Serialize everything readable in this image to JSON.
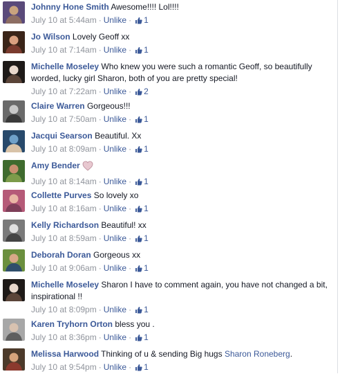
{
  "comments": [
    {
      "name": "Johnny Hone Smith",
      "text": "Awesome!!!! Lol!!!!",
      "time": "July 10 at 5:44am",
      "action": "Unlike",
      "likes": "1",
      "avatar_colors": [
        "#5a4a7a",
        "#c9a37e",
        "#8d6e63"
      ]
    },
    {
      "name": "Jo Wilson",
      "text": "Lovely Geoff xx",
      "time": "July 10 at 7:14am",
      "action": "Unlike",
      "likes": "1",
      "avatar_colors": [
        "#3a2418",
        "#d9a080",
        "#7a3b2e"
      ]
    },
    {
      "name": "Michelle Moseley",
      "text": "Who knew you were such a romantic Geoff, so beautifully worded, lucky girl Sharon, both of you are pretty special!",
      "time": "July 10 at 7:22am",
      "action": "Unlike",
      "likes": "2",
      "avatar_colors": [
        "#1e1a18",
        "#e8d8cc",
        "#5a4438"
      ]
    },
    {
      "name": "Claire Warren",
      "text": "Gorgeous!!!",
      "time": "July 10 at 7:50am",
      "action": "Unlike",
      "likes": "1",
      "avatar_colors": [
        "#6a6a6a",
        "#c8c8c8",
        "#3a3a3a"
      ]
    },
    {
      "name": "Jacqui Searson",
      "text": "Beautiful. Xx",
      "time": "July 10 at 8:09am",
      "action": "Unlike",
      "likes": "1",
      "avatar_colors": [
        "#27496b",
        "#6fa1c9",
        "#d8c3a8"
      ]
    },
    {
      "name": "Amy Bender",
      "text": "",
      "heart": true,
      "time": "July 10 at 8:14am",
      "action": "Unlike",
      "likes": "1",
      "avatar_colors": [
        "#3f6b2e",
        "#c89070",
        "#7c9b4a"
      ]
    },
    {
      "name": "Collette Purves",
      "text": "So lovely xo",
      "time": "July 10 at 8:16am",
      "action": "Unlike",
      "likes": "1",
      "avatar_colors": [
        "#b55a78",
        "#e9b7a5",
        "#7e3f59"
      ]
    },
    {
      "name": "Kelly Richardson",
      "text": "Beautiful! xx",
      "time": "July 10 at 8:59am",
      "action": "Unlike",
      "likes": "1",
      "avatar_colors": [
        "#7a7a7a",
        "#e0e0e0",
        "#444444"
      ]
    },
    {
      "name": "Deborah Doran",
      "text": "Gorgeous xx",
      "time": "July 10 at 9:06am",
      "action": "Unlike",
      "likes": "1",
      "avatar_colors": [
        "#6b8f3e",
        "#d7a888",
        "#2f4e6b"
      ]
    },
    {
      "name": "Michelle Moseley",
      "text": "Sharon I have to comment again, you have not changed a bit, inspirational !!",
      "time": "July 10 at 8:09pm",
      "action": "Unlike",
      "likes": "1",
      "avatar_colors": [
        "#1e1a18",
        "#e8d8cc",
        "#5a4438"
      ]
    },
    {
      "name": "Karen Tryhorn Orton",
      "text": "bless you .",
      "time": "July 10 at 8:36pm",
      "action": "Unlike",
      "likes": "1",
      "avatar_colors": [
        "#a7a7a7",
        "#d8c2b0",
        "#5f5f5f"
      ]
    },
    {
      "name": "Melissa Harwood",
      "text": "Thinking of u & sending Big hugs",
      "mention": "Sharon Roneberg",
      "text_after": ".",
      "time": "July 10 at 9:54pm",
      "action": "Unlike",
      "likes": "1",
      "avatar_colors": [
        "#4c3a2a",
        "#d6a47c",
        "#8b3a2e"
      ]
    }
  ]
}
